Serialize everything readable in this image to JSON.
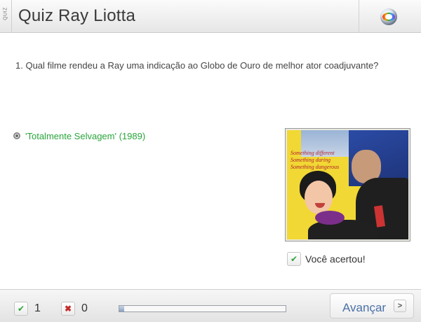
{
  "header": {
    "side_tab": "QUIZ",
    "title": "Quiz Ray Liotta",
    "logo_icon": "globo-logo-icon"
  },
  "question": {
    "text": "1. Qual filme rendeu a Ray uma indicação ao Globo de Ouro de melhor ator coadjuvante?"
  },
  "answer": {
    "option_text": "'Totalmente Selvagem' (1989)",
    "option_color": "#2aa53b",
    "poster_tagline": [
      "Something different",
      "Something daring",
      "Something dangerous"
    ]
  },
  "result": {
    "icon": "check-icon",
    "text": "Você acertou!"
  },
  "footer": {
    "correct_icon": "check-icon",
    "correct_count": "1",
    "wrong_icon": "x-icon",
    "wrong_count": "0",
    "progress": 0.03,
    "next_label": "Avançar",
    "next_icon": "chevron-right-icon"
  }
}
